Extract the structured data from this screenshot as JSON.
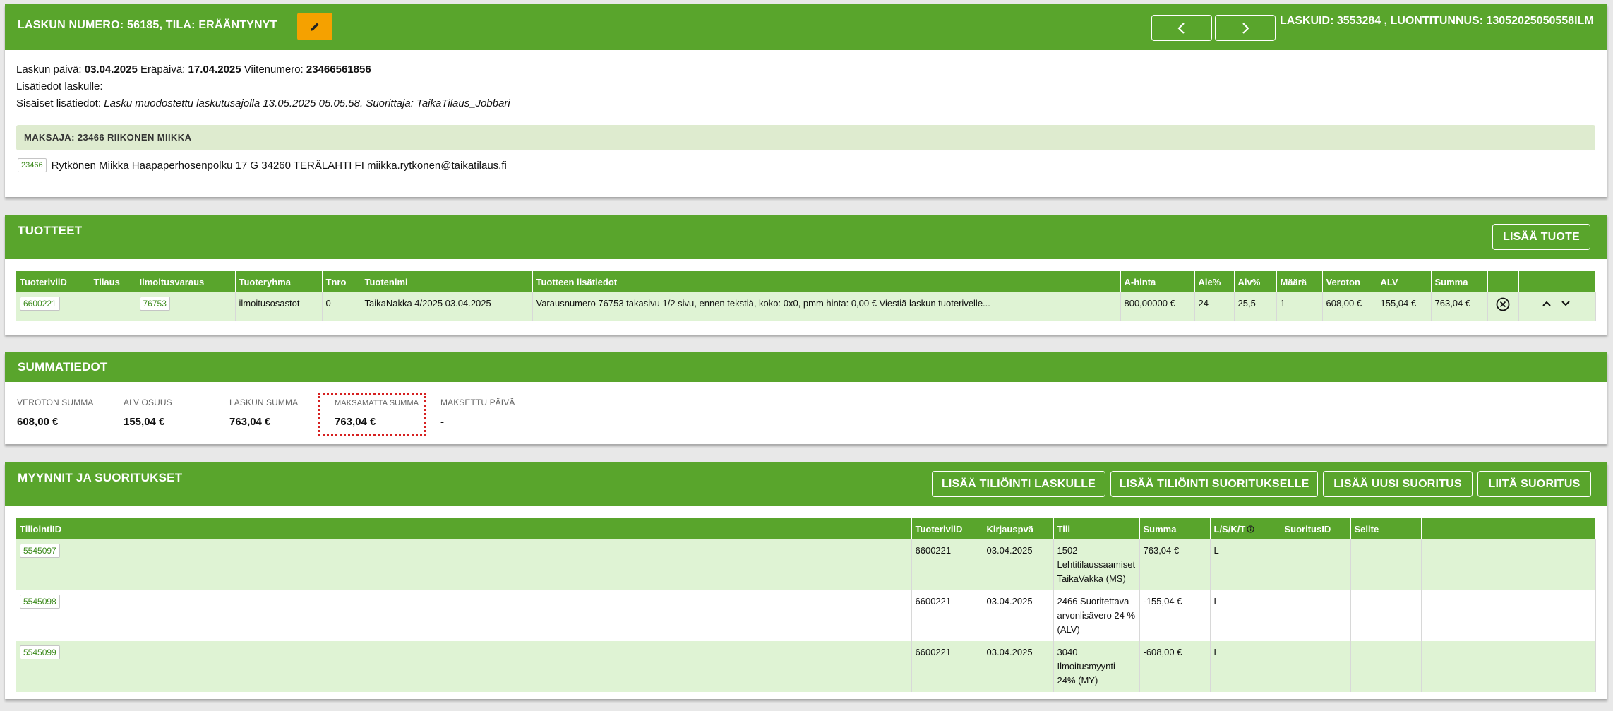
{
  "header": {
    "title_prefix": "LASKUN NUMERO: ",
    "invoice_number": "56185",
    "status_prefix": ", TILA: ",
    "status": "ERÄÄNTYNYT",
    "meta_text": "LASKUID: 3553284 , LUONTITUNNUS: 13052025050558ILM"
  },
  "info": {
    "date_label": "Laskun päivä: ",
    "date": "03.04.2025",
    "due_label": " Eräpäivä: ",
    "due": "17.04.2025",
    "ref_label": " Viitenumero: ",
    "ref": "23466561856",
    "extra_label": "Lisätiedot laskulle:",
    "internal_label": "Sisäiset lisätiedot: ",
    "internal_text": "Lasku muodostettu laskutusajolla 13.05.2025 05.05.58. Suorittaja: TaikaTilaus_Jobbari",
    "payer_label": "MAKSAJA: ",
    "payer": "23466 RIIKONEN MIIKKA",
    "customer_id": "23466",
    "customer_text": "Rytkönen Miikka Haapaperhosenpolku 17 G 34260 TERÄLAHTI FI miikka.rytkonen@taikatilaus.fi"
  },
  "products": {
    "title": "TUOTTEET",
    "add_button": "LISÄÄ TUOTE",
    "columns": [
      "TuoterivilD",
      "Tilaus",
      "Ilmoitusvaraus",
      "Tuoteryhma",
      "Tnro",
      "Tuotenimi",
      "Tuotteen lisätiedot",
      "A-hinta",
      "Ale%",
      "Alv%",
      "Määrä",
      "Veroton",
      "ALV",
      "Summa",
      "",
      "",
      ""
    ],
    "row": {
      "id": "6600221",
      "order": "",
      "reservation": "76753",
      "group": "ilmoitusosastot",
      "tnro": "0",
      "name": "TaikaNakka 4/2025 03.04.2025",
      "details": "Varausnumero 76753 takasivu 1/2 sivu, ennen tekstiä, koko: 0x0, pmm hinta: 0,00 € Viestiä laskun tuoterivelle...",
      "price": "800,00000 €",
      "discount": "24",
      "vat_pct": "25,5",
      "qty": "1",
      "net": "608,00 €",
      "vat": "155,04 €",
      "sum": "763,04 €"
    }
  },
  "summary": {
    "title": "SUMMATIEDOT",
    "items": [
      {
        "label": "VEROTON SUMMA",
        "value": "608,00 €"
      },
      {
        "label": "ALV OSUUS",
        "value": "155,04 €"
      },
      {
        "label": "LASKUN SUMMA",
        "value": "763,04 €"
      },
      {
        "label": "MAKSAMATTA SUMMA",
        "value": "763,04 €"
      },
      {
        "label": "MAKSETTU PÄIVÄ",
        "value": "-"
      }
    ]
  },
  "sales": {
    "title": "MYYNNIT JA SUORITUKSET",
    "buttons": [
      "LISÄÄ TILIÖINTI LASKULLE",
      "LISÄÄ TILIÖINTI SUORITUKSELLE",
      "LISÄÄ UUSI SUORITUS",
      "LIITÄ SUORITUS"
    ],
    "columns": [
      "TiliointiID",
      "TuoterivilD",
      "Kirjauspvä",
      "Tili",
      "Summa",
      "L/S/K/T",
      "SuoritusID",
      "Selite",
      ""
    ],
    "rows": [
      {
        "id": "5545097",
        "product_row": "6600221",
        "date": "03.04.2025",
        "account": "1502 Lehtitilaussaamiset TaikaVakka (MS)",
        "sum": "763,04 €",
        "type": "L",
        "payment": "",
        "desc": ""
      },
      {
        "id": "5545098",
        "product_row": "6600221",
        "date": "03.04.2025",
        "account": "2466 Suoritettava arvonlisävero 24 % (ALV)",
        "sum": "-155,04 €",
        "type": "L",
        "payment": "",
        "desc": ""
      },
      {
        "id": "5545099",
        "product_row": "6600221",
        "date": "03.04.2025",
        "account": "3040 Ilmoitusmyynti 24% (MY)",
        "sum": "-608,00 €",
        "type": "L",
        "payment": "",
        "desc": ""
      }
    ]
  },
  "colors": {
    "brand": "#59a52c",
    "row_highlight": "#dff3d4",
    "edit_button": "#f5a100",
    "unpaid_border": "#d62020"
  }
}
